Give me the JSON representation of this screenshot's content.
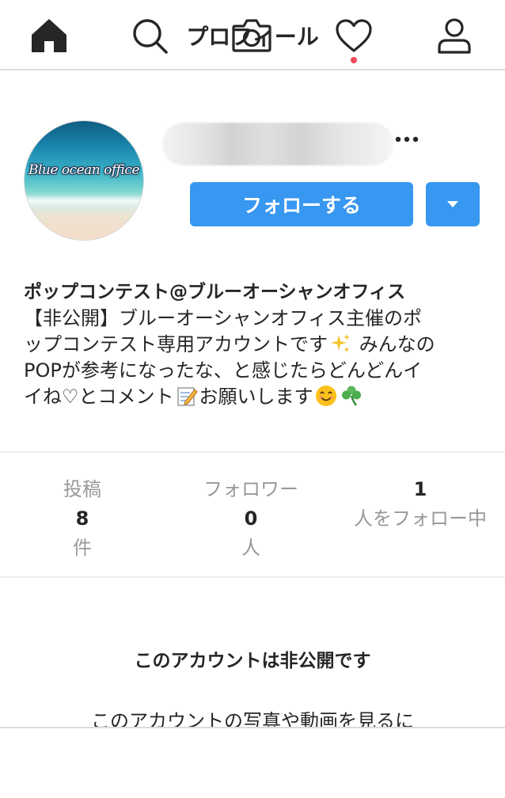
{
  "header": {
    "title": "プロフィール"
  },
  "profile": {
    "avatar_text": "Blue ocean office",
    "follow_label": "フォローする",
    "more_icon": "more-dots-icon",
    "dropdown_icon": "caret-down-icon"
  },
  "bio": {
    "name": "ポップコンテスト@ブルーオーシャンオフィス",
    "line1": "【非公開】ブルーオーシャンオフィス主催のポ",
    "line2": "ップコンテスト専用アカウントです",
    "line2b": " みんなの",
    "line3": "POPが参考になったな、と感じたらどんどんイ",
    "line4": "イね♡とコメント",
    "line4b": "お願いします",
    "emojis": [
      "sparkles-icon",
      "memo-icon",
      "smile-icon",
      "clover-icon"
    ]
  },
  "stats": [
    {
      "label": "投稿",
      "value": "8",
      "unit": "件"
    },
    {
      "label": "フォロワー",
      "value": "0",
      "unit": "人"
    },
    {
      "value": "1",
      "label": "人をフォロー中"
    }
  ],
  "private": {
    "title": "このアカウントは非公開です",
    "description": "このアカウントの写真や動画を見るに"
  },
  "tabbar": {
    "items": [
      "home-icon",
      "search-icon",
      "camera-icon",
      "heart-icon",
      "profile-icon"
    ],
    "active": "home",
    "notification_color": "#ed4956"
  },
  "colors": {
    "accent": "#3897f0",
    "text": "#262626",
    "muted": "#999999"
  }
}
